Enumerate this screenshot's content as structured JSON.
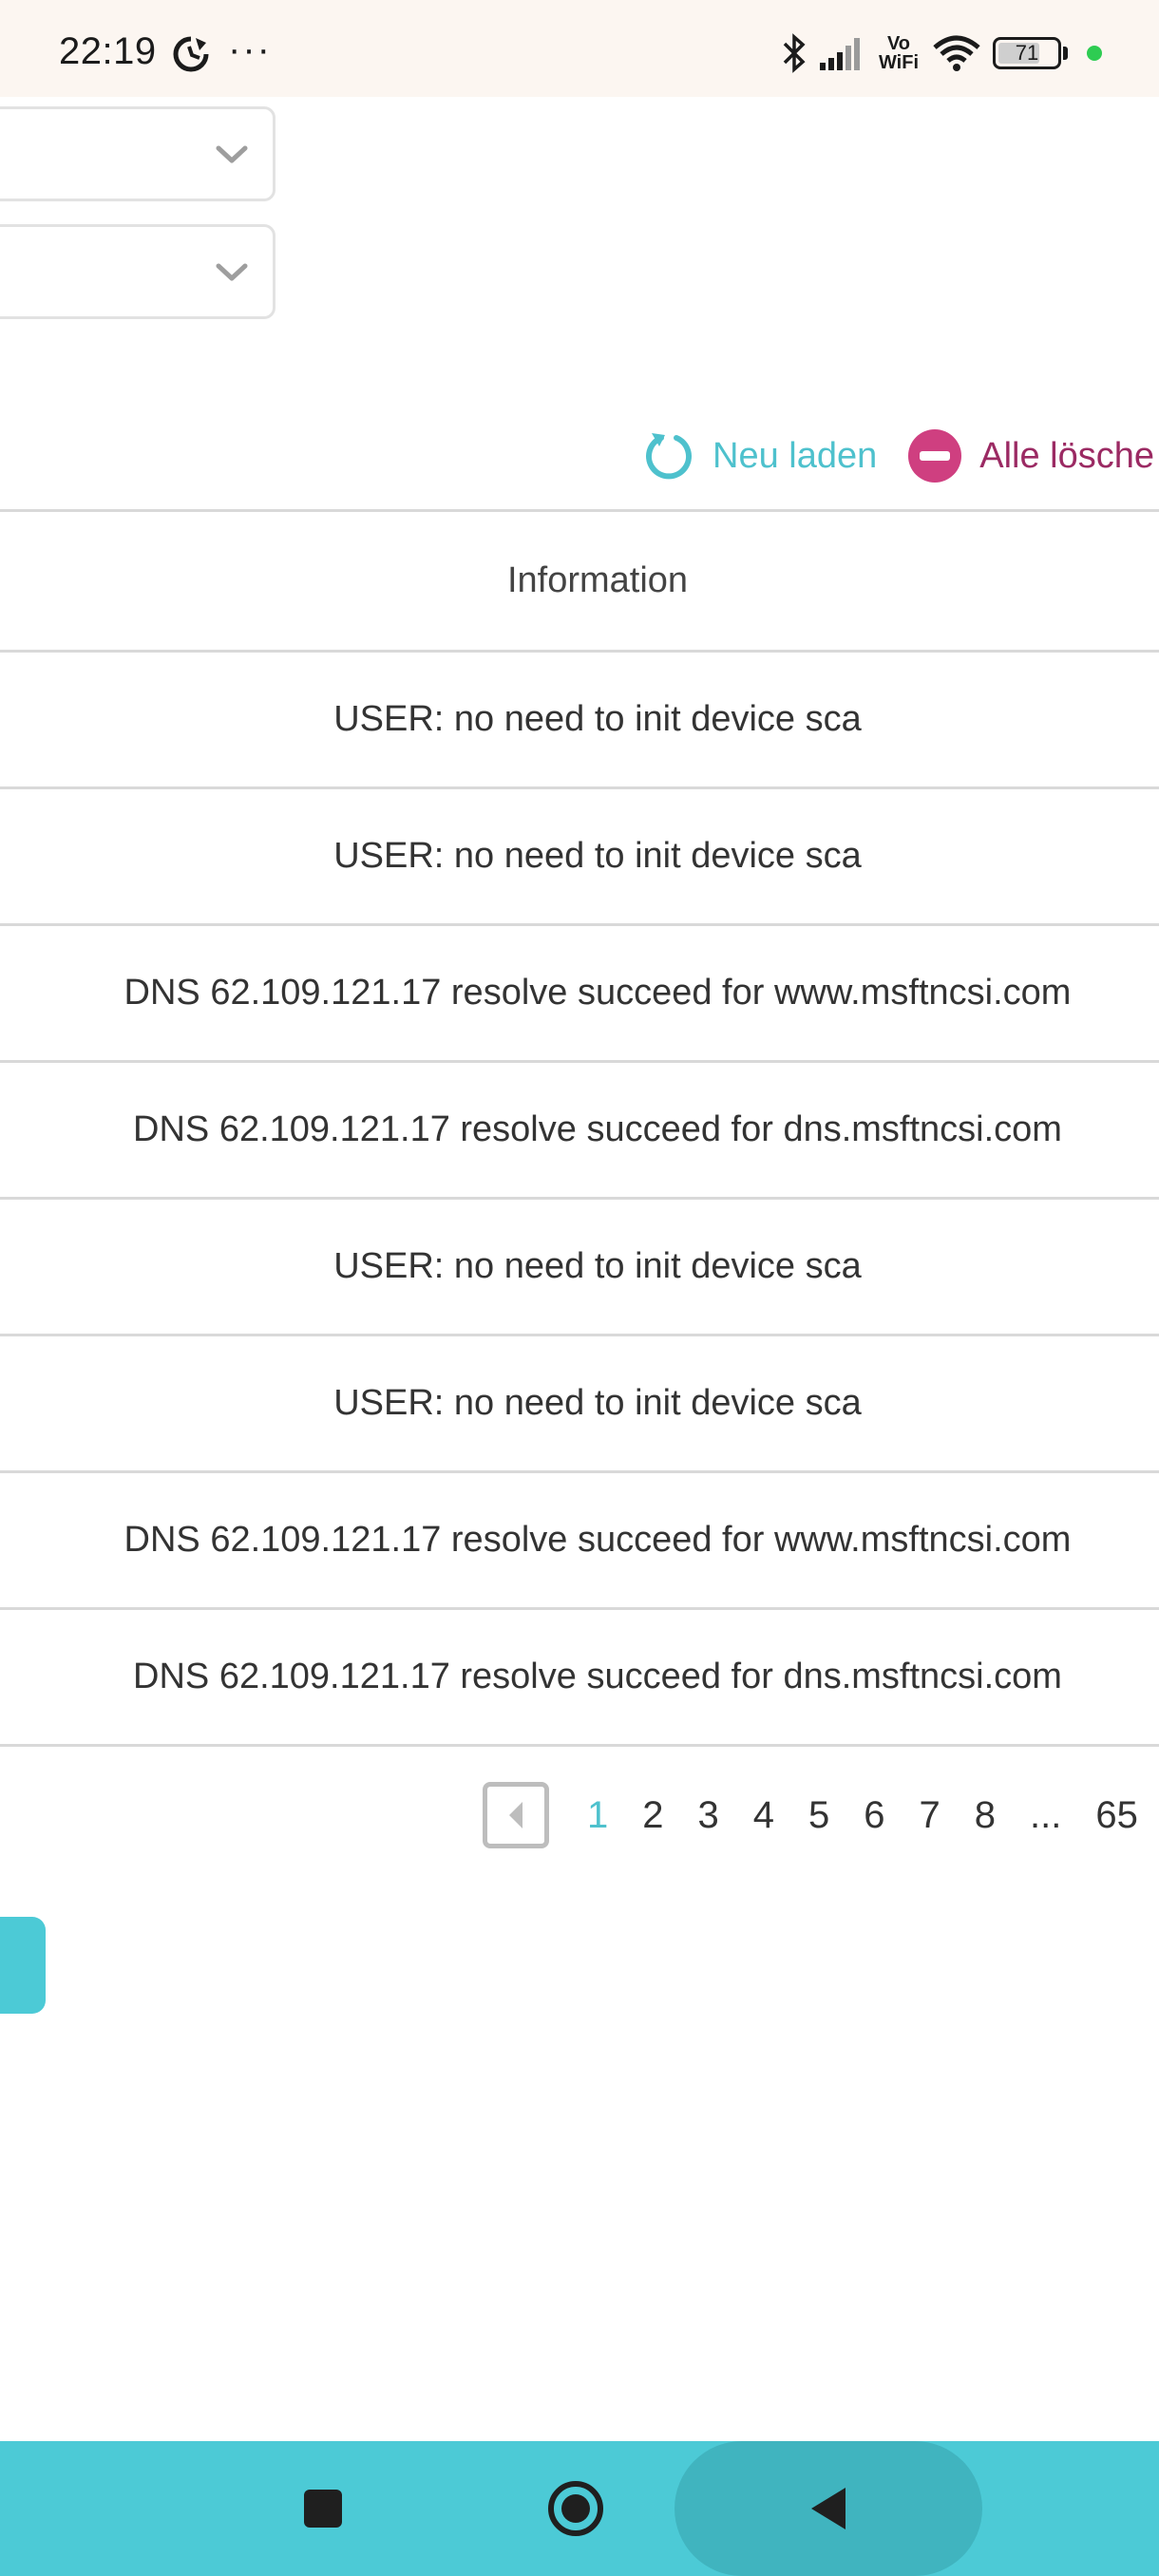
{
  "status_bar": {
    "time": "22:19",
    "more": "···",
    "vowifi_top": "Vo",
    "vowifi_bottom": "WiFi",
    "battery_level": "71",
    "battery_fraction": 0.71,
    "icons": [
      "sync-icon",
      "bluetooth-icon",
      "signal-icon",
      "vowifi-icon",
      "wifi-icon",
      "battery-icon"
    ]
  },
  "selects": [
    {
      "value": "",
      "icon": "chevron-down-icon"
    },
    {
      "value": "",
      "icon": "chevron-down-icon"
    }
  ],
  "actions": {
    "reload_label": "Neu laden",
    "delete_all_label": "Alle lösche"
  },
  "table": {
    "header": "Information",
    "rows": [
      "USER: no need to init device sca",
      "USER: no need to init device sca",
      "DNS 62.109.121.17 resolve succeed for www.msftncsi.com",
      "DNS 62.109.121.17 resolve succeed for dns.msftncsi.com",
      "USER: no need to init device sca",
      "USER: no need to init device sca",
      "DNS 62.109.121.17 resolve succeed for www.msftncsi.com",
      "DNS 62.109.121.17 resolve succeed for dns.msftncsi.com"
    ]
  },
  "pagination": {
    "pages": [
      "1",
      "2",
      "3",
      "4",
      "5",
      "6",
      "7",
      "8",
      "...",
      "65"
    ],
    "current": "1"
  },
  "colors": {
    "accent": "#4ec1cd",
    "delete": "#9b2a63",
    "navbar": "#4ccad6"
  }
}
